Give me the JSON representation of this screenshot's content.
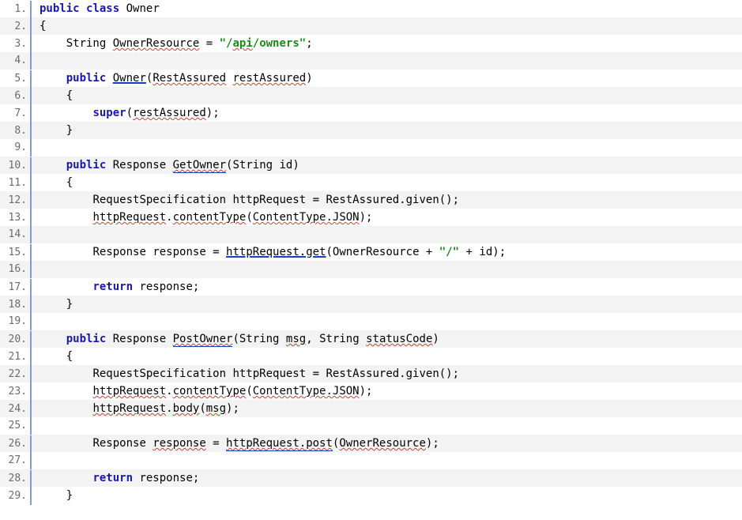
{
  "lines": {
    "l1": {
      "num": "1."
    },
    "l2": {
      "num": "2."
    },
    "l3": {
      "num": "3."
    },
    "l4": {
      "num": "4."
    },
    "l5": {
      "num": "5."
    },
    "l6": {
      "num": "6."
    },
    "l7": {
      "num": "7."
    },
    "l8": {
      "num": "8."
    },
    "l9": {
      "num": "9."
    },
    "l10": {
      "num": "10."
    },
    "l11": {
      "num": "11."
    },
    "l12": {
      "num": "12."
    },
    "l13": {
      "num": "13."
    },
    "l14": {
      "num": "14."
    },
    "l15": {
      "num": "15."
    },
    "l16": {
      "num": "16."
    },
    "l17": {
      "num": "17."
    },
    "l18": {
      "num": "18."
    },
    "l19": {
      "num": "19."
    },
    "l20": {
      "num": "20."
    },
    "l21": {
      "num": "21."
    },
    "l22": {
      "num": "22."
    },
    "l23": {
      "num": "23."
    },
    "l24": {
      "num": "24."
    },
    "l25": {
      "num": "25."
    },
    "l26": {
      "num": "26."
    },
    "l27": {
      "num": "27."
    },
    "l28": {
      "num": "28."
    },
    "l29": {
      "num": "29."
    }
  },
  "tokens": {
    "public": "public",
    "class": "class",
    "super": "super",
    "return": "return",
    "Owner": "Owner",
    "String": "String",
    "OwnerResource": "OwnerResource",
    "eq": " = ",
    "apiOwners": "\"/api/owners\"",
    "semi": ";",
    "RestAssuredType": "RestAssured",
    "restAssuredParam": "restAssured",
    "Response": "Response",
    "GetOwner": "GetOwner",
    "id": "id",
    "RequestSpecification": "RequestSpecification",
    "httpRequest": "httpRequest",
    "given": "RestAssured.given()",
    "contentType": "contentType",
    "ContentTypeJSON": "ContentType.JSON",
    "response": "response",
    "httpRequestGet": "httpRequest.get",
    "slash": "\"/\"",
    "plus": " + ",
    "PostOwner": "PostOwner",
    "msg": "msg",
    "statusCode": "statusCode",
    "body": "body",
    "httpRequestPost": "httpRequest.post",
    "lbrace": "{",
    "rbrace": "}",
    "lparen": "(",
    "rparen": ")",
    "comma": ", ",
    "dot": "."
  }
}
